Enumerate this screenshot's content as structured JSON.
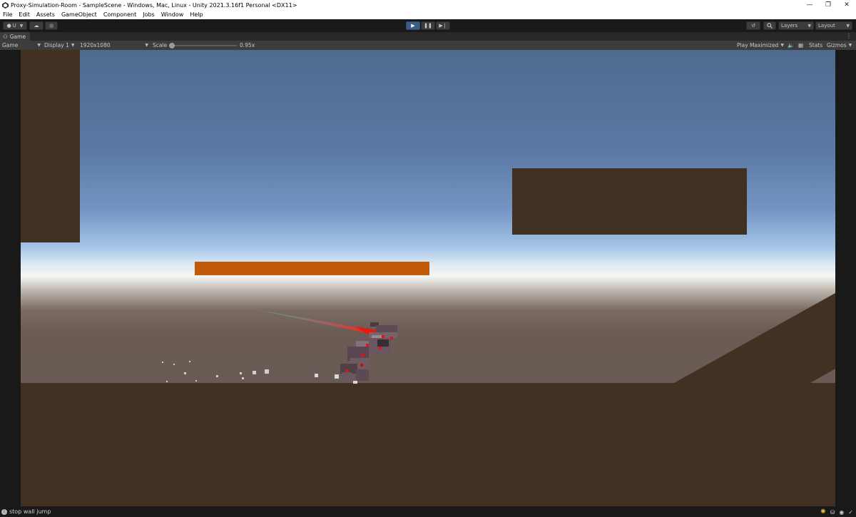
{
  "window": {
    "title": "Proxy-Simulation-Room - SampleScene - Windows, Mac, Linux - Unity 2021.3.16f1 Personal <DX11>",
    "controls": [
      "minimize",
      "restore",
      "close"
    ]
  },
  "menu": [
    "File",
    "Edit",
    "Assets",
    "GameObject",
    "Component",
    "Jobs",
    "Window",
    "Help"
  ],
  "toolbar": {
    "account_label": "U",
    "play_state": "playing",
    "layers_label": "Layers",
    "layout_label": "Layout"
  },
  "panel": {
    "tab_label": "Game"
  },
  "game_toolbar": {
    "view_mode": "Game",
    "display": "Display 1",
    "resolution": "1920x1080",
    "scale_label": "Scale",
    "scale_value": "0.95x",
    "play_mode": "Play Maximized",
    "stats_label": "Stats",
    "gizmos_label": "Gizmos"
  },
  "status": {
    "message": "stop wall jump"
  },
  "colors": {
    "ground": "#413122",
    "platform_orange": "#c35a07",
    "play_active": "#3b5e86",
    "editor_bg": "#191919"
  }
}
